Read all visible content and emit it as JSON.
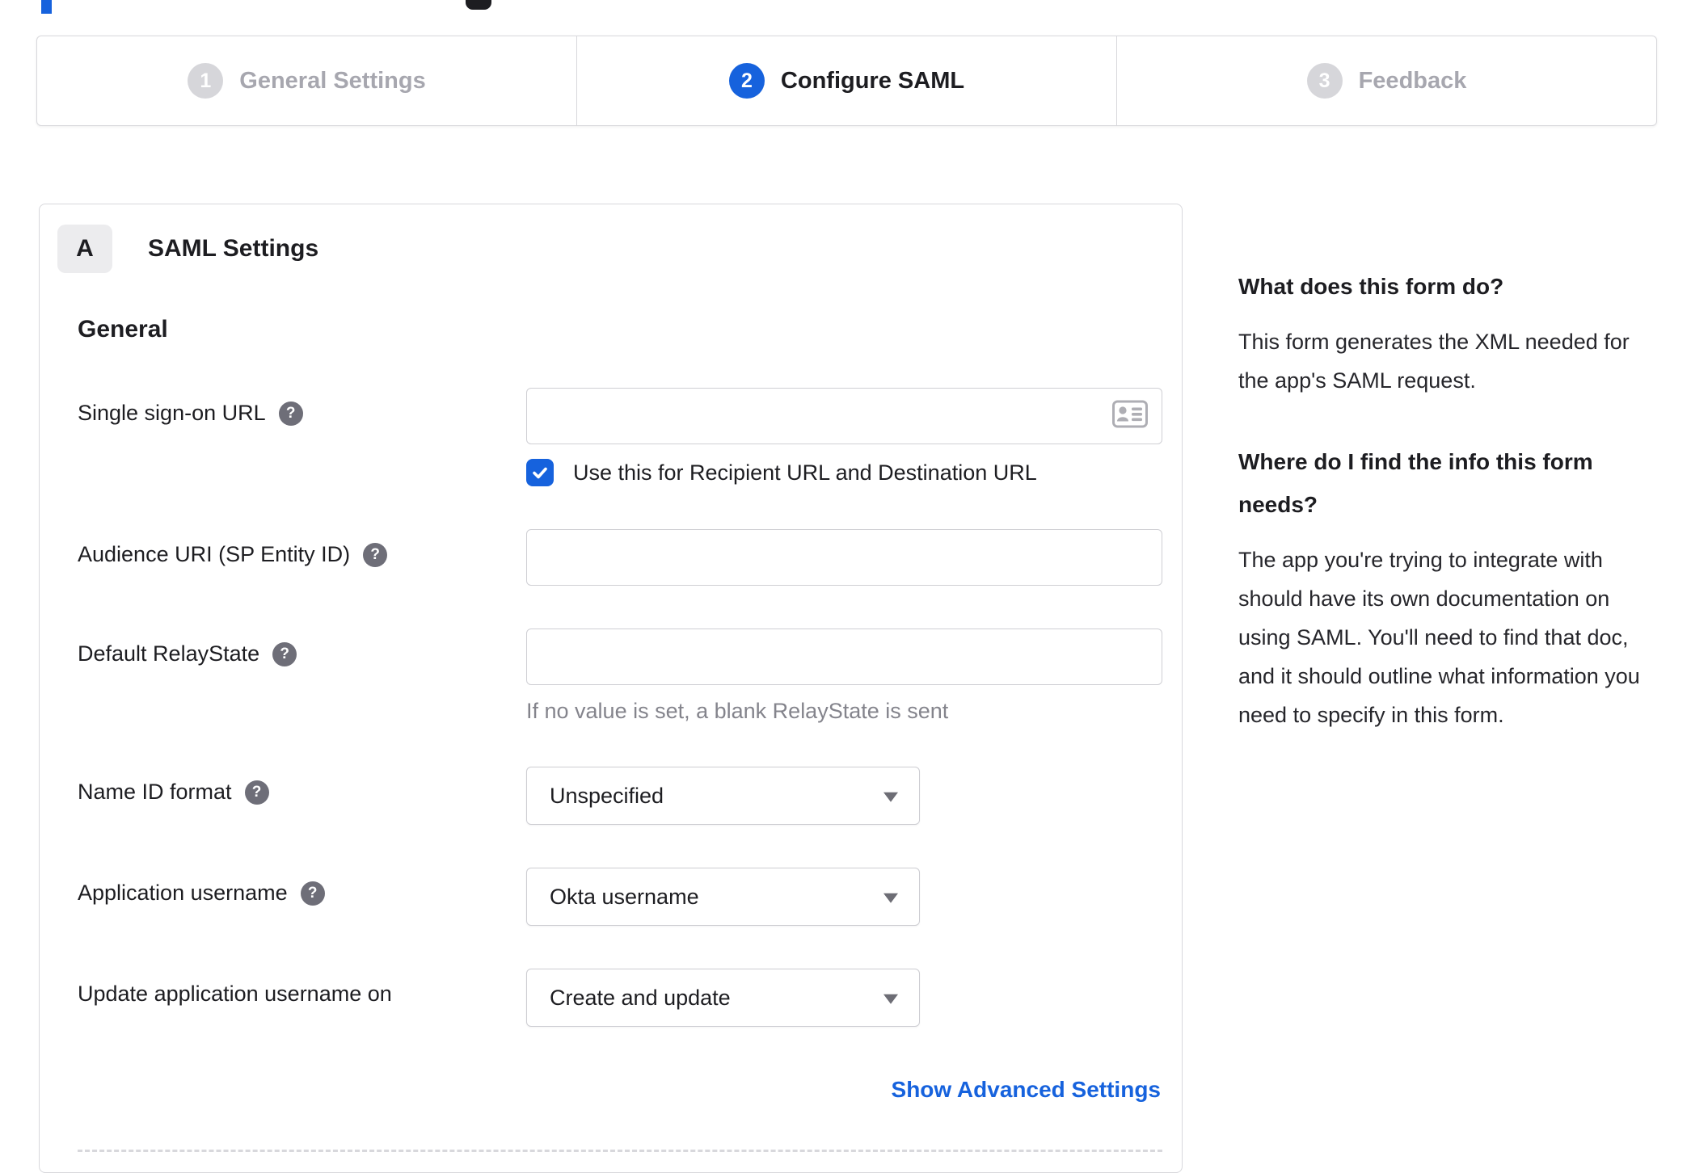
{
  "stepper": {
    "steps": [
      {
        "number": "1",
        "label": "General Settings",
        "state": "inactive"
      },
      {
        "number": "2",
        "label": "Configure SAML",
        "state": "active"
      },
      {
        "number": "3",
        "label": "Feedback",
        "state": "inactive"
      }
    ]
  },
  "panel": {
    "badge": "A",
    "title": "SAML Settings",
    "section": "General",
    "sso": {
      "label": "Single sign-on URL",
      "value": "",
      "checkbox_label": "Use this for Recipient URL and Destination URL",
      "checked": true
    },
    "audience": {
      "label": "Audience URI (SP Entity ID)",
      "value": ""
    },
    "relaystate": {
      "label": "Default RelayState",
      "value": "",
      "hint": "If no value is set, a blank RelayState is sent"
    },
    "nameid": {
      "label": "Name ID format",
      "value": "Unspecified"
    },
    "appusername": {
      "label": "Application username",
      "value": "Okta username"
    },
    "updateusername": {
      "label": "Update application username on",
      "value": "Create and update"
    },
    "advanced_link": "Show Advanced Settings"
  },
  "sidebar": {
    "q1": "What does this form do?",
    "a1": "This form generates the XML needed for the app's SAML request.",
    "q2": "Where do I find the info this form needs?",
    "a2": "The app you're trying to integrate with should have its own documentation on using SAML. You'll need to find that doc, and it should outline what information you need to specify in this form."
  },
  "colors": {
    "accent_blue": "#1662dd",
    "text_dark": "#1d1d21",
    "muted_gray": "#84848c",
    "border_gray": "#d8d8dc"
  }
}
